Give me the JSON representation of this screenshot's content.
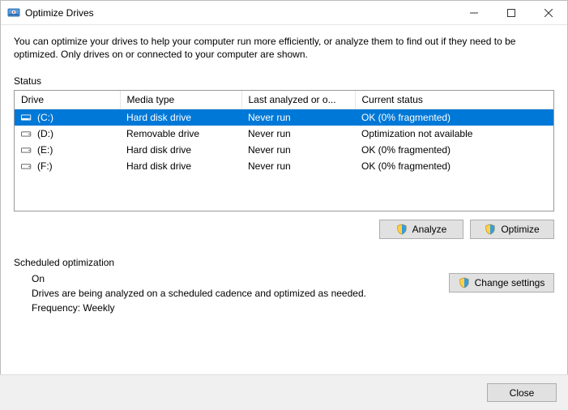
{
  "window": {
    "title": "Optimize Drives"
  },
  "description": "You can optimize your drives to help your computer run more efficiently, or analyze them to find out if they need to be optimized. Only drives on or connected to your computer are shown.",
  "status_label": "Status",
  "columns": {
    "drive": "Drive",
    "media": "Media type",
    "last": "Last analyzed or o...",
    "current": "Current status"
  },
  "drives": [
    {
      "name": "(C:)",
      "media": "Hard disk drive",
      "last": "Never run",
      "status": "OK (0% fragmented)",
      "selected": true,
      "icon": "system"
    },
    {
      "name": "(D:)",
      "media": "Removable drive",
      "last": "Never run",
      "status": "Optimization not available",
      "selected": false,
      "icon": "hdd"
    },
    {
      "name": "(E:)",
      "media": "Hard disk drive",
      "last": "Never run",
      "status": "OK (0% fragmented)",
      "selected": false,
      "icon": "hdd"
    },
    {
      "name": "(F:)",
      "media": "Hard disk drive",
      "last": "Never run",
      "status": "OK (0% fragmented)",
      "selected": false,
      "icon": "hdd"
    }
  ],
  "buttons": {
    "analyze": "Analyze",
    "optimize": "Optimize",
    "change": "Change settings",
    "close": "Close"
  },
  "schedule": {
    "label": "Scheduled optimization",
    "state": "On",
    "desc": "Drives are being analyzed on a scheduled cadence and optimized as needed.",
    "freq": "Frequency: Weekly"
  }
}
